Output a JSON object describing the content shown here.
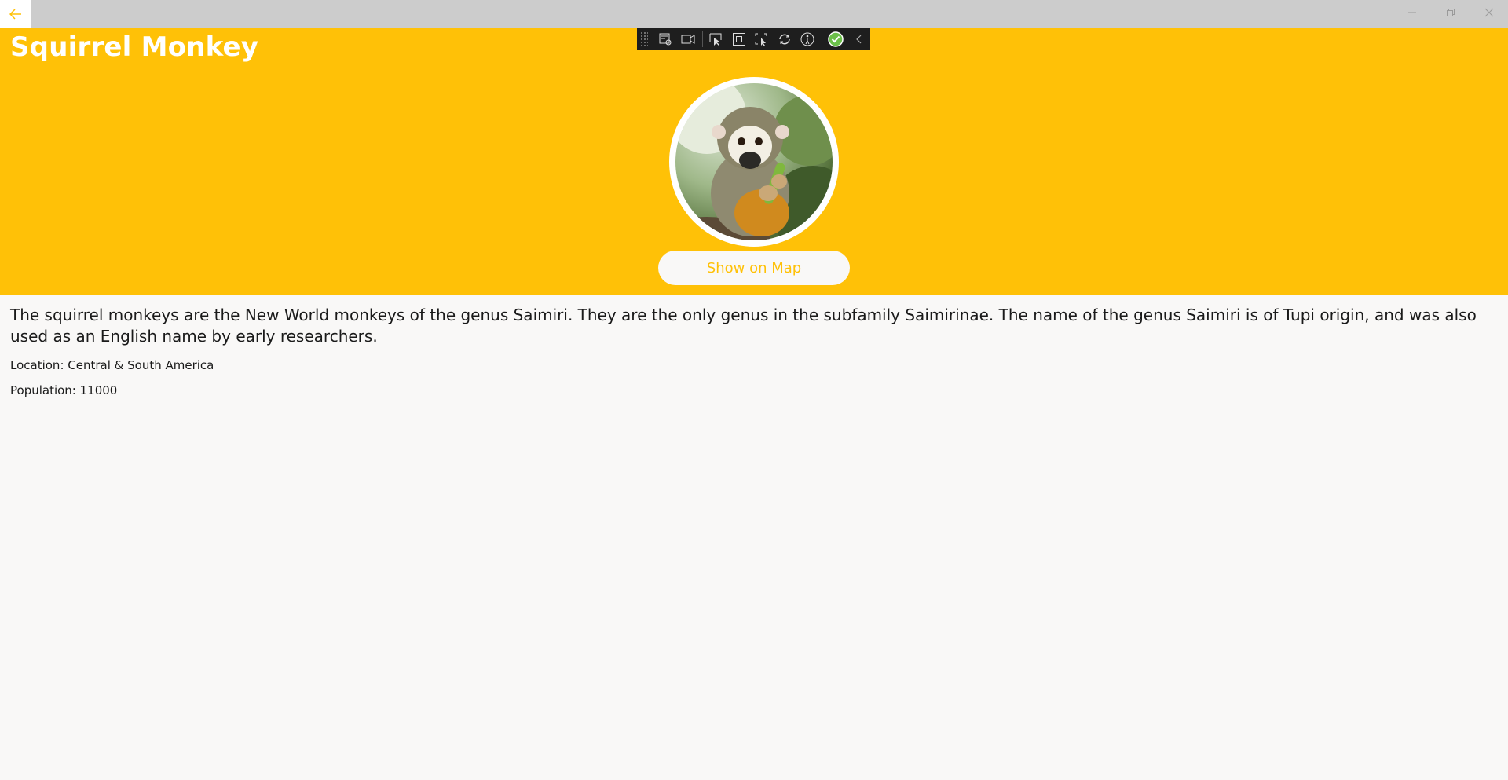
{
  "window": {
    "back_icon": "arrow-left-icon",
    "minimize_icon": "minimize-icon",
    "maximize_icon": "restore-icon",
    "close_icon": "close-icon"
  },
  "header": {
    "title": "Squirrel Monkey",
    "background_color": "#ffc107"
  },
  "debug_toolbar": {
    "icons": [
      "grip-icon",
      "live-visual-tree-icon",
      "video-icon",
      "select-element-icon",
      "display-layout-adorners-icon",
      "track-focus-icon",
      "hot-reload-icon",
      "accessibility-icon",
      "check-circle-icon",
      "collapse-chevron-icon"
    ]
  },
  "animal": {
    "image_alt": "squirrel-monkey-photo",
    "map_button_label": "Show on Map",
    "description": "The squirrel monkeys are the New World monkeys of the genus Saimiri. They are the only genus in the subfamily Saimirinae. The name of the genus Saimiri is of Tupi origin, and was also used as an English name by early researchers.",
    "location": "Location: Central & South America",
    "population": "Population: 11000"
  }
}
